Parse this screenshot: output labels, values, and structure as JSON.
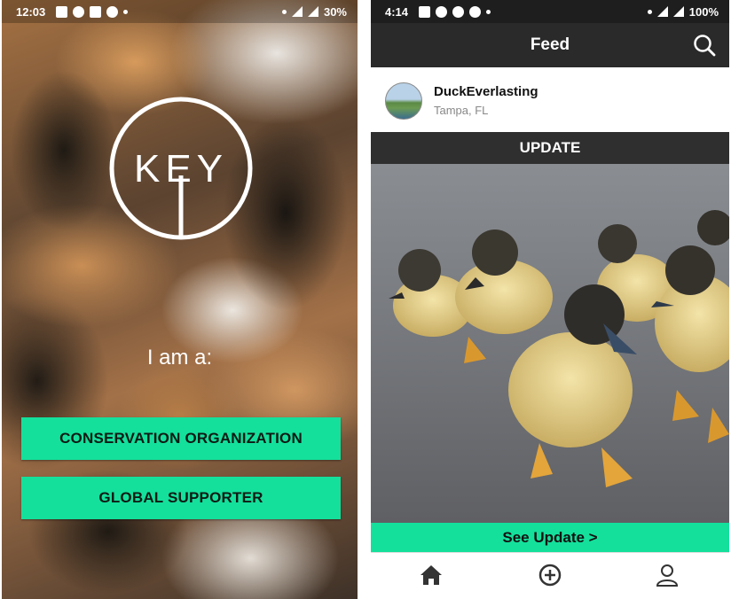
{
  "left": {
    "status": {
      "time": "12:03",
      "battery": "30%"
    },
    "logo_text": "KEY",
    "prompt": "I am a:",
    "buttons": [
      {
        "label": "CONSERVATION ORGANIZATION"
      },
      {
        "label": "GLOBAL SUPPORTER"
      }
    ],
    "accent_color": "#14e09c"
  },
  "right": {
    "status": {
      "time": "4:14",
      "battery": "100%"
    },
    "appbar": {
      "title": "Feed",
      "action_icon": "search-icon"
    },
    "post": {
      "username": "DuckEverlasting",
      "location": "Tampa, FL",
      "section_label": "UPDATE",
      "image_subject": "ducklings",
      "cta_label": "See Update >"
    },
    "bottom_nav": [
      {
        "icon": "home-icon"
      },
      {
        "icon": "add-circle-icon"
      },
      {
        "icon": "profile-icon"
      }
    ],
    "accent_color": "#14e09c"
  }
}
